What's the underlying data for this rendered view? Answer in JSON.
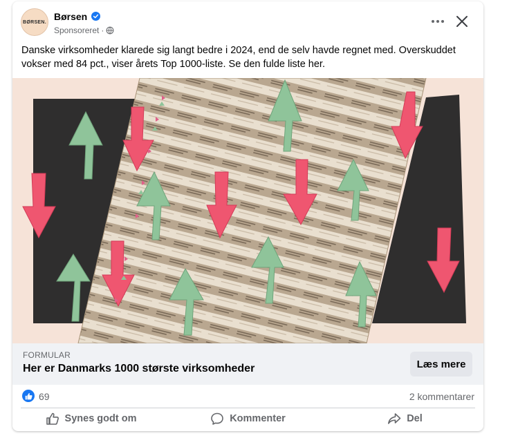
{
  "post": {
    "page_name": "Børsen",
    "avatar_text": "BØRSEN.",
    "sponsored": "Sponsoreret",
    "separator": "·",
    "caption": "Danske virksomheder klarede sig langt bedre i 2024, end de selv havde regnet med. Overskuddet vokser med 84 pct., viser årets Top 1000-liste. Se den fulde liste her."
  },
  "icons": {
    "verified": "verified-badge-icon",
    "audience": "globe-icon",
    "more": "more-horizontal-icon",
    "close": "close-icon",
    "like": "thumbs-up-icon",
    "comment": "comment-bubble-icon",
    "share": "share-arrow-icon"
  },
  "colors": {
    "accent_blue": "#1877f2",
    "arrow_green": "#8fc49a",
    "arrow_red": "#ef5670",
    "paper_beige": "#e8dcc9",
    "dark_panel": "#2f2e2e",
    "background_pink": "#f6e3d8"
  },
  "cta": {
    "domain": "FORMULAR",
    "title": "Her er Danmarks 1000 største virksomheder",
    "button": "Læs mere"
  },
  "stats": {
    "likes": "69",
    "comments": "2 kommentarer"
  },
  "actions": {
    "like": "Synes godt om",
    "comment": "Kommenter",
    "share": "Del"
  }
}
